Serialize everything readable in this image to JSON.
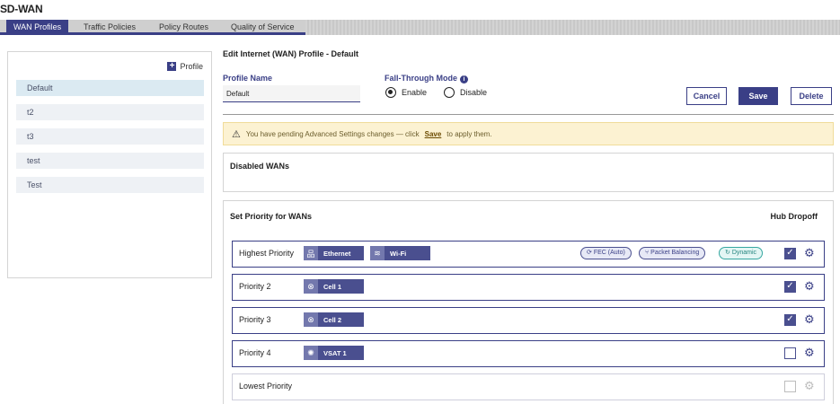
{
  "app": {
    "title": "SD-WAN"
  },
  "tabs": [
    {
      "label": "WAN Profiles",
      "active": true
    },
    {
      "label": "Traffic Policies"
    },
    {
      "label": "Policy Routes"
    },
    {
      "label": "Quality of Service"
    }
  ],
  "sidebar": {
    "add_label": "Profile",
    "profiles": [
      "Default",
      "t2",
      "t3",
      "test",
      "Test"
    ]
  },
  "editor": {
    "title": "Edit Internet (WAN) Profile - Default",
    "profile_name_label": "Profile Name",
    "profile_name_value": "Default",
    "fallthrough_label": "Fall-Through Mode",
    "enable_label": "Enable",
    "disable_label": "Disable",
    "cancel": "Cancel",
    "save": "Save",
    "delete": "Delete"
  },
  "warning": {
    "prefix": "You have pending Advanced Settings changes — click",
    "link": "Save",
    "suffix": "to apply them."
  },
  "disabled_wans": {
    "title": "Disabled WANs"
  },
  "priority": {
    "title": "Set Priority for WANs",
    "hub_dropoff": "Hub Dropoff",
    "rows": [
      {
        "label": "Highest Priority",
        "wans": [
          "Ethernet",
          "Wi-Fi"
        ],
        "tags": [
          "FEC (Auto)",
          "Packet Balancing",
          "Dynamic"
        ],
        "hub": true
      },
      {
        "label": "Priority 2",
        "wans": [
          "Cell 1"
        ],
        "hub": true
      },
      {
        "label": "Priority 3",
        "wans": [
          "Cell 2"
        ],
        "hub": true
      },
      {
        "label": "Priority 4",
        "wans": [
          "VSAT 1"
        ],
        "hub": false
      },
      {
        "label": "Lowest Priority",
        "wans": [],
        "hub": false
      }
    ]
  },
  "colors": {
    "accent": "#3a3f86",
    "warning_bg": "#fcf2d2",
    "selected_bg": "#dbeaf2"
  }
}
